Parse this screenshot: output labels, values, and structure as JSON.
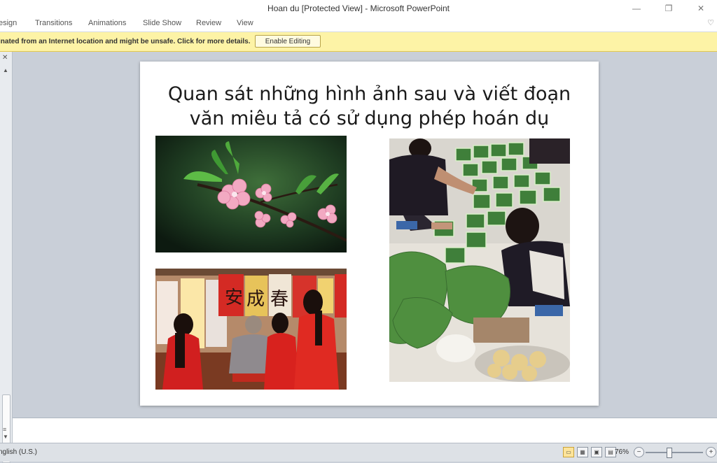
{
  "window": {
    "title": "Hoan du [Protected View] - Microsoft PowerPoint",
    "minimize_glyph": "—",
    "restore_glyph": "❐",
    "close_glyph": "✕"
  },
  "ribbon": {
    "tabs": [
      "esign",
      "Transitions",
      "Animations",
      "Slide Show",
      "Review",
      "View"
    ],
    "help_glyph": "♡"
  },
  "message_bar": {
    "text": "inated from an Internet location and might be unsafe. Click for more details.",
    "enable_label": "Enable Editing",
    "color": "#fdf3a6"
  },
  "left_pane": {
    "close_glyph": "✕",
    "up_glyph": "▲",
    "down_glyph": "▼",
    "grip_glyph": "≡"
  },
  "slide": {
    "title_line1": "Quan sát những hình ảnh sau và viết đoạn",
    "title_line2": "văn miêu tả có sử dụng phép hoán dụ",
    "images": [
      {
        "name": "peach-blossom-photo"
      },
      {
        "name": "calligraphy-tet-photo"
      },
      {
        "name": "banh-chung-wrapping-photo"
      }
    ],
    "calligraphy_chars": [
      "安",
      "成",
      "春"
    ]
  },
  "status_bar": {
    "language": "nglish (U.S.)",
    "zoom": "76%",
    "zoom_level": 0.76,
    "minus_glyph": "−",
    "plus_glyph": "+"
  }
}
